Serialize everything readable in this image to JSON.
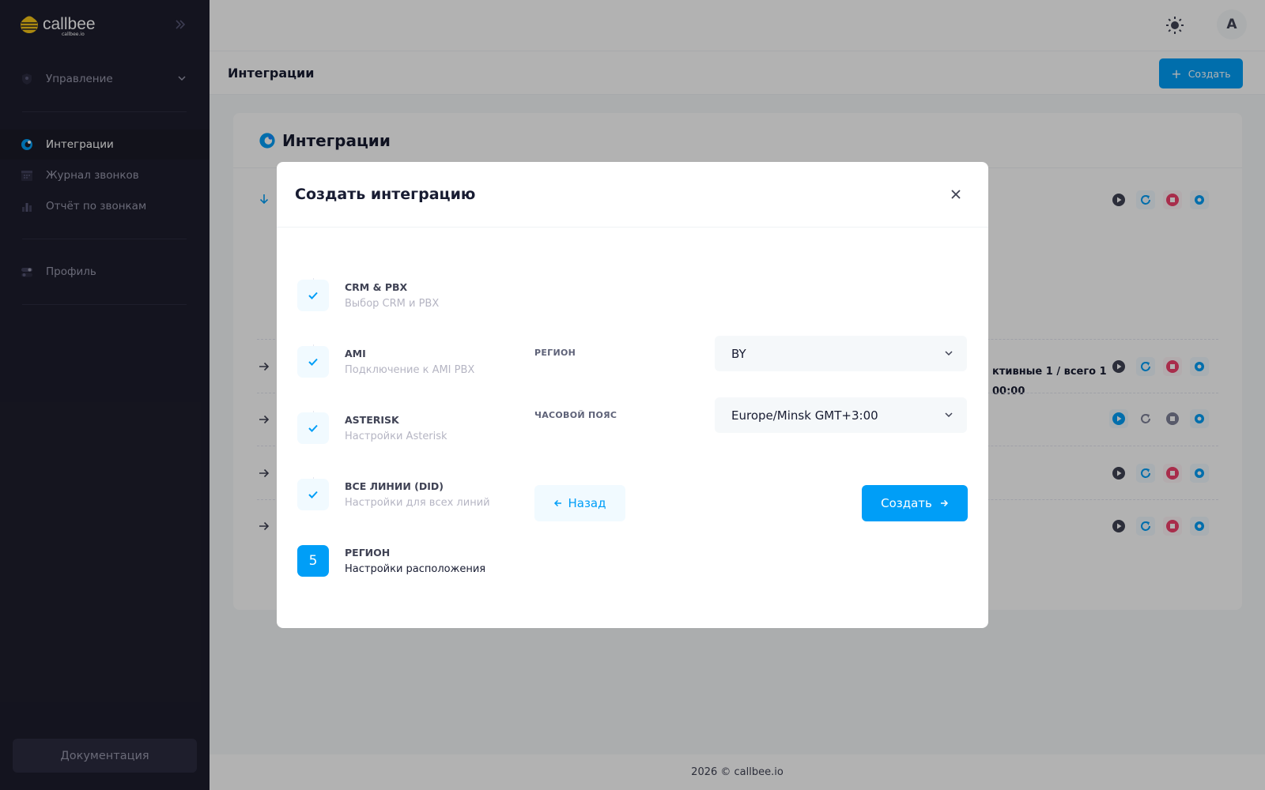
{
  "brand": {
    "name": "callbee",
    "sub": "callbee.io"
  },
  "sidebar": {
    "items": [
      {
        "label": "Управление",
        "icon": "shield-icon"
      },
      {
        "label": "Интеграции",
        "icon": "integration-icon"
      },
      {
        "label": "Журнал звонков",
        "icon": "calendar-icon"
      },
      {
        "label": "Отчёт по звонкам",
        "icon": "chart-icon"
      },
      {
        "label": "Профиль",
        "icon": "toggle-icon"
      }
    ],
    "docs_label": "Документация"
  },
  "header": {
    "avatar_letter": "A"
  },
  "toolbar": {
    "title": "Интеграции",
    "create_label": "Создать"
  },
  "card": {
    "title": "Интеграции",
    "info_line1": "ктивные 1 / всего 1",
    "info_line2": "00:00"
  },
  "footer": {
    "text": "2026 © callbee.io"
  },
  "modal": {
    "title": "Создать интеграцию",
    "steps": [
      {
        "title": "CRM & PBX",
        "desc": "Выбор CRM и PBX",
        "status": "done"
      },
      {
        "title": "AMI",
        "desc": "Подключение к AMI PBX",
        "status": "done"
      },
      {
        "title": "ASTERISK",
        "desc": "Настройки Asterisk",
        "status": "done"
      },
      {
        "title": "ВСЕ ЛИНИИ (DID)",
        "desc": "Настройки для всех линий",
        "status": "done"
      },
      {
        "title": "РЕГИОН",
        "desc": "Настройки расположения",
        "status": "current",
        "number": "5"
      }
    ],
    "region_label": "РЕГИОН",
    "region_value": "BY",
    "timezone_label": "ЧАСОВОЙ ПОЯС",
    "timezone_value": "Europe/Minsk GMT+3:00",
    "back_label": "Назад",
    "submit_label": "Создать"
  },
  "colors": {
    "primary": "#009ef7",
    "sidebar_bg": "#1e1e2d",
    "danger": "#f1416c"
  }
}
